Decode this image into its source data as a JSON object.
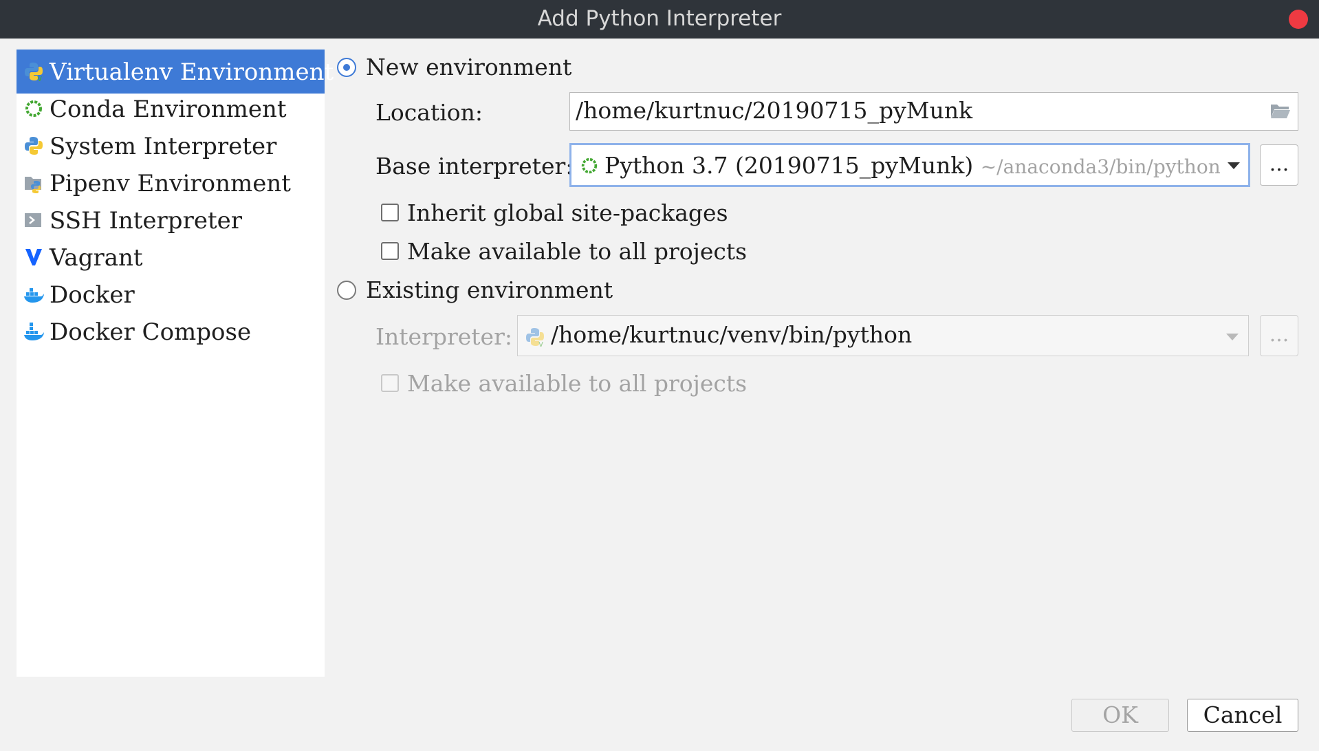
{
  "window": {
    "title": "Add Python Interpreter"
  },
  "sidebar": {
    "items": [
      {
        "label": "Virtualenv Environment",
        "icon": "virtualenv-python-icon",
        "selected": true
      },
      {
        "label": "Conda Environment",
        "icon": "conda-ring-icon"
      },
      {
        "label": "System Interpreter",
        "icon": "python-icon"
      },
      {
        "label": "Pipenv Environment",
        "icon": "pipenv-folder-icon"
      },
      {
        "label": "SSH Interpreter",
        "icon": "ssh-terminal-icon"
      },
      {
        "label": "Vagrant",
        "icon": "vagrant-icon"
      },
      {
        "label": "Docker",
        "icon": "docker-whale-icon"
      },
      {
        "label": "Docker Compose",
        "icon": "docker-whale-icon"
      }
    ]
  },
  "new_env": {
    "radio_label": "New environment",
    "selected": true,
    "location_label": "Location:",
    "location_value": "/home/kurtnuc/20190715_pyMunk",
    "base_label": "Base interpreter:",
    "base_value": "Python 3.7 (20190715_pyMunk)",
    "base_hint": "~/anaconda3/bin/python",
    "browse_label": "...",
    "inherit_label": "Inherit global site-packages",
    "available_label": "Make available to all projects"
  },
  "existing_env": {
    "radio_label": "Existing environment",
    "interpreter_label": "Interpreter:",
    "interpreter_value": "/home/kurtnuc/venv/bin/python",
    "browse_label": "...",
    "available_label": "Make available to all projects"
  },
  "footer": {
    "ok_label": "OK",
    "cancel_label": "Cancel"
  },
  "colors": {
    "accent": "#3e7ad6",
    "titlebar": "#2f343a",
    "close": "#ee3a42",
    "conda_green": "#44a833"
  }
}
